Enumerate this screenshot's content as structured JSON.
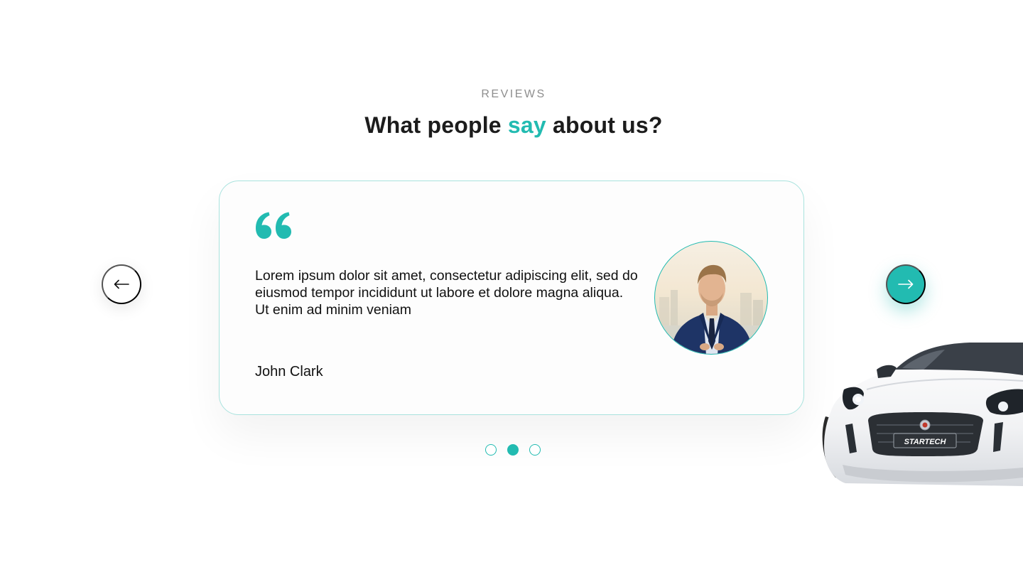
{
  "section": {
    "eyebrow": "REVIEWS",
    "heading_before": "What people ",
    "heading_accent": "say",
    "heading_after": " about us?"
  },
  "review": {
    "text": "Lorem ipsum dolor sit amet, consectetur adipiscing elit, sed do eiusmod tempor incididunt ut labore et dolore magna aliqua. Ut enim ad minim veniam",
    "author": "John Clark",
    "quote_icon": "quote-icon",
    "avatar": "avatar-photo"
  },
  "carousel": {
    "prev_icon": "arrow-left-icon",
    "next_icon": "arrow-right-icon",
    "slide_count": 3,
    "active_slide": 2
  },
  "decoration": {
    "car_badge": "STARTECH"
  },
  "colors": {
    "accent": "#22bbb1",
    "heading": "#1c1c1c",
    "eyebrow": "#8e8e8e",
    "card_border": "#a9e3de"
  }
}
